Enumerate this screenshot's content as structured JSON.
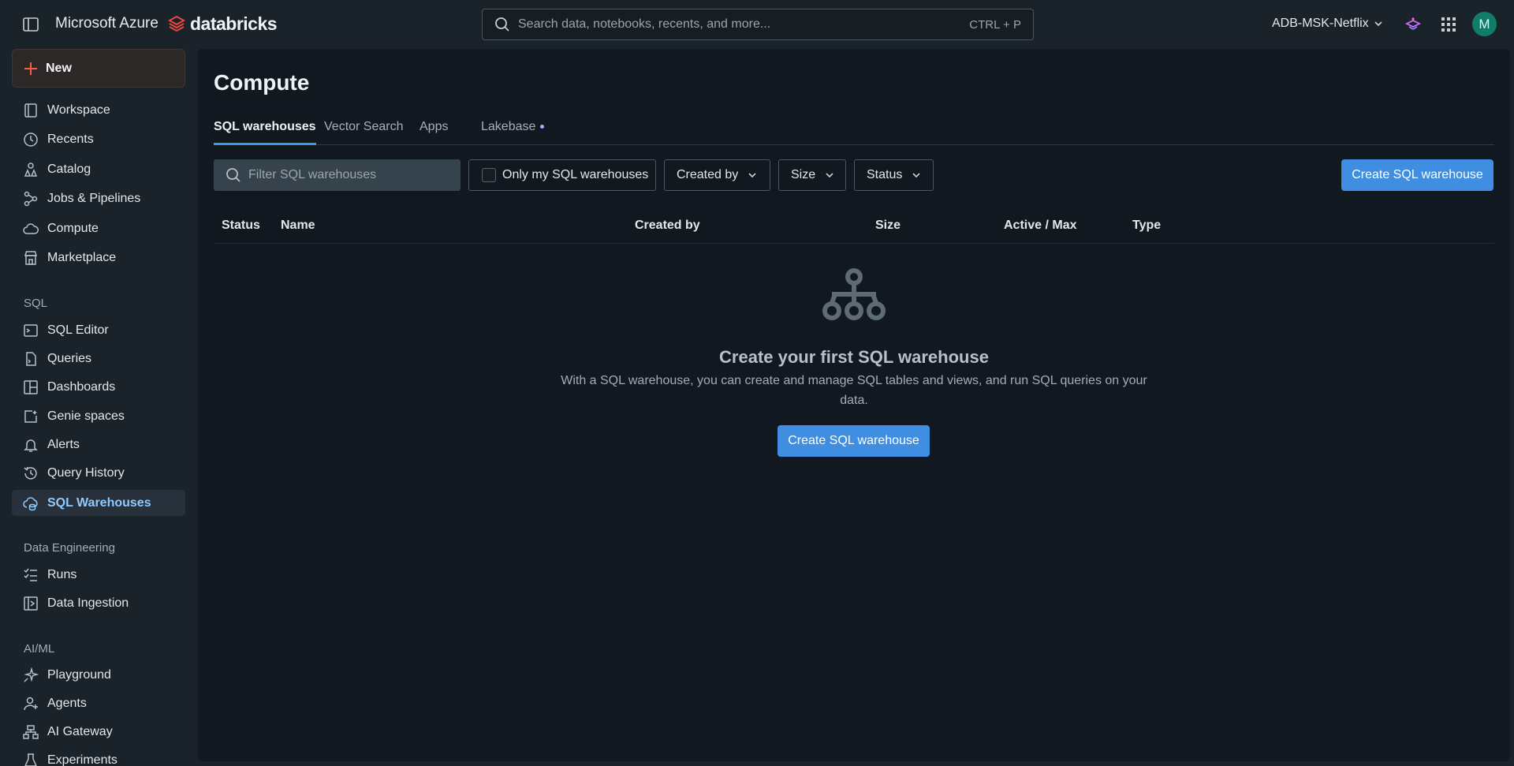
{
  "topbar": {
    "brand_azure": "Microsoft Azure",
    "brand_databricks": "databricks",
    "search_placeholder": "Search data, notebooks, recents, and more...",
    "search_shortcut": "CTRL + P",
    "workspace_name": "ADB-MSK-Netflix",
    "avatar_initial": "M"
  },
  "sidebar": {
    "new_label": "New",
    "main_items": [
      {
        "label": "Workspace",
        "icon": "workspace-icon"
      },
      {
        "label": "Recents",
        "icon": "clock-icon"
      },
      {
        "label": "Catalog",
        "icon": "catalog-icon"
      },
      {
        "label": "Jobs & Pipelines",
        "icon": "workflow-icon"
      },
      {
        "label": "Compute",
        "icon": "cloud-icon"
      },
      {
        "label": "Marketplace",
        "icon": "store-icon"
      }
    ],
    "sql_section": "SQL",
    "sql_items": [
      {
        "label": "SQL Editor",
        "icon": "terminal-icon"
      },
      {
        "label": "Queries",
        "icon": "query-file-icon"
      },
      {
        "label": "Dashboards",
        "icon": "dashboard-icon"
      },
      {
        "label": "Genie spaces",
        "icon": "genie-icon"
      },
      {
        "label": "Alerts",
        "icon": "bell-icon"
      },
      {
        "label": "Query History",
        "icon": "history-icon"
      },
      {
        "label": "SQL Warehouses",
        "icon": "warehouse-icon"
      }
    ],
    "de_section": "Data Engineering",
    "de_items": [
      {
        "label": "Runs",
        "icon": "runs-list-icon"
      },
      {
        "label": "Data Ingestion",
        "icon": "ingestion-icon"
      }
    ],
    "ml_section": "AI/ML",
    "ml_items": [
      {
        "label": "Playground",
        "icon": "sparkle-icon"
      },
      {
        "label": "Agents",
        "icon": "agent-icon"
      },
      {
        "label": "AI Gateway",
        "icon": "gateway-icon"
      },
      {
        "label": "Experiments",
        "icon": "flask-icon"
      }
    ]
  },
  "main": {
    "title": "Compute",
    "tabs": [
      {
        "label": "SQL warehouses"
      },
      {
        "label": "Vector Search"
      },
      {
        "label": "Apps"
      },
      {
        "label": "Lakebase"
      }
    ],
    "filter_placeholder": "Filter SQL warehouses",
    "only_mine_label": "Only my SQL warehouses",
    "created_by_filter": "Created by",
    "size_filter": "Size",
    "status_filter": "Status",
    "create_button": "Create SQL warehouse",
    "columns": [
      "Status",
      "Name",
      "Created by",
      "Size",
      "Active / Max",
      "Type"
    ],
    "empty_title": "Create your first SQL warehouse",
    "empty_description": "With a SQL warehouse, you can create and manage SQL tables and views, and run SQL queries on your data.",
    "empty_button": "Create SQL warehouse"
  },
  "colors": {
    "accent": "#3f8ee2",
    "active_nav_text": "#8ecbff",
    "brand_red": "#e84a3a"
  }
}
